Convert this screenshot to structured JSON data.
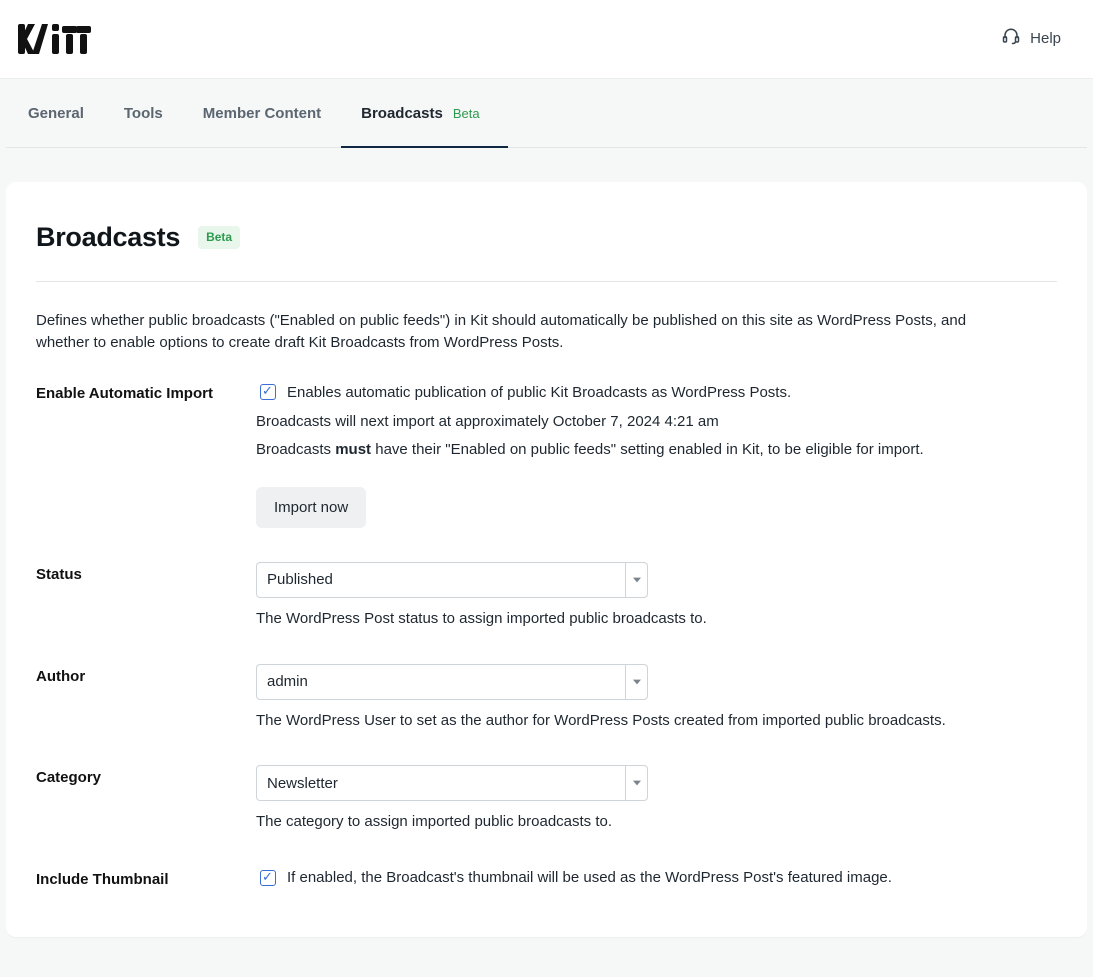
{
  "header": {
    "help_label": "Help"
  },
  "tabs": [
    {
      "label": "General"
    },
    {
      "label": "Tools"
    },
    {
      "label": "Member Content"
    },
    {
      "label": "Broadcasts",
      "beta": "Beta",
      "active": true
    }
  ],
  "panel": {
    "title": "Broadcasts",
    "beta": "Beta",
    "description": "Defines whether public broadcasts (\"Enabled on public feeds\") in Kit should automatically be published on this site as WordPress Posts, and whether to enable options to create draft Kit Broadcasts from WordPress Posts."
  },
  "fields": {
    "enable_import": {
      "label": "Enable Automatic Import",
      "checkbox_label": "Enables automatic publication of public Kit Broadcasts as WordPress Posts.",
      "next_import_line": "Broadcasts will next import at approximately October 7, 2024 4:21 am",
      "must_line_prefix": "Broadcasts ",
      "must_word": "must",
      "must_line_suffix": " have their \"Enabled on public feeds\" setting enabled in Kit, to be eligible for import.",
      "import_button": "Import now"
    },
    "status": {
      "label": "Status",
      "value": "Published",
      "help": "The WordPress Post status to assign imported public broadcasts to."
    },
    "author": {
      "label": "Author",
      "value": "admin",
      "help": "The WordPress User to set as the author for WordPress Posts created from imported public broadcasts."
    },
    "category": {
      "label": "Category",
      "value": "Newsletter",
      "help": "The category to assign imported public broadcasts to."
    },
    "include_thumbnail": {
      "label": "Include Thumbnail",
      "checkbox_label": "If enabled, the Broadcast's thumbnail will be used as the WordPress Post's featured image."
    }
  }
}
